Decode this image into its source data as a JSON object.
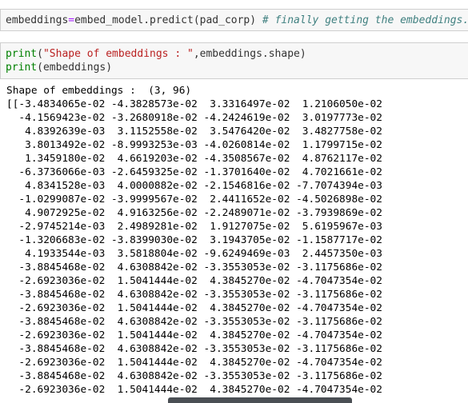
{
  "cell1": {
    "var": "embeddings",
    "eq": "=",
    "call": "embed_model.predict(pad_corp)",
    "comment": "# finally getting the embeddings."
  },
  "cell2": {
    "print1_fn": "print",
    "print1_str": "\"Shape of embeddings : \"",
    "print1_rest": ",embeddings.shape)",
    "print2_fn": "print",
    "print2_rest": "(embeddings)"
  },
  "output": {
    "shape_line": "Shape of embeddings :  (3, 96)",
    "rows": [
      "[[-3.4834065e-02 -4.3828573e-02  3.3316497e-02  1.2106050e-02",
      "  -4.1569423e-02 -3.2680918e-02 -4.2424619e-02  3.0197773e-02",
      "   4.8392639e-03  3.1152558e-02  3.5476420e-02  3.4827758e-02",
      "   3.8013492e-02 -8.9993253e-03 -4.0260814e-02  1.1799715e-02",
      "   1.3459180e-02  4.6619203e-02 -4.3508567e-02  4.8762117e-02",
      "  -6.3736066e-03 -2.6459325e-02 -1.3701640e-02  4.7021661e-02",
      "   4.8341528e-03  4.0000882e-02 -2.1546816e-02 -7.7074394e-03",
      "  -1.0299087e-02 -3.9999567e-02  2.4411652e-02 -4.5026898e-02",
      "   4.9072925e-02  4.9163256e-02 -2.2489071e-02 -3.7939869e-02",
      "  -2.9745214e-03  2.4989281e-02  1.9127075e-02  5.6195967e-03",
      "  -1.3206683e-02 -3.8399030e-02  3.1943705e-02 -1.1587717e-02",
      "   4.1933544e-03  3.5818804e-02 -9.6249469e-03  2.4457350e-03",
      "  -3.8845468e-02  4.6308842e-02 -3.3553053e-02 -3.1175686e-02",
      "  -2.6923036e-02  1.5041444e-02  4.3845270e-02 -4.7047354e-02",
      "  -3.8845468e-02  4.6308842e-02 -3.3553053e-02 -3.1175686e-02",
      "  -2.6923036e-02  1.5041444e-02  4.3845270e-02 -4.7047354e-02",
      "  -3.8845468e-02  4.6308842e-02 -3.3553053e-02 -3.1175686e-02",
      "  -2.6923036e-02  1.5041444e-02  4.3845270e-02 -4.7047354e-02",
      "  -3.8845468e-02  4.6308842e-02 -3.3553053e-02 -3.1175686e-02",
      "  -2.6923036e-02  1.5041444e-02  4.3845270e-02 -4.7047354e-02",
      "  -3.8845468e-02  4.6308842e-02 -3.3553053e-02 -3.1175686e-02",
      "  -2.6923036e-02  1.5041444e-02  4.3845270e-02 -4.7047354e-02"
    ]
  },
  "colors": {
    "keyword": "#008000",
    "string": "#ba2121",
    "operator": "#aa22ff",
    "comment": "#408080"
  }
}
